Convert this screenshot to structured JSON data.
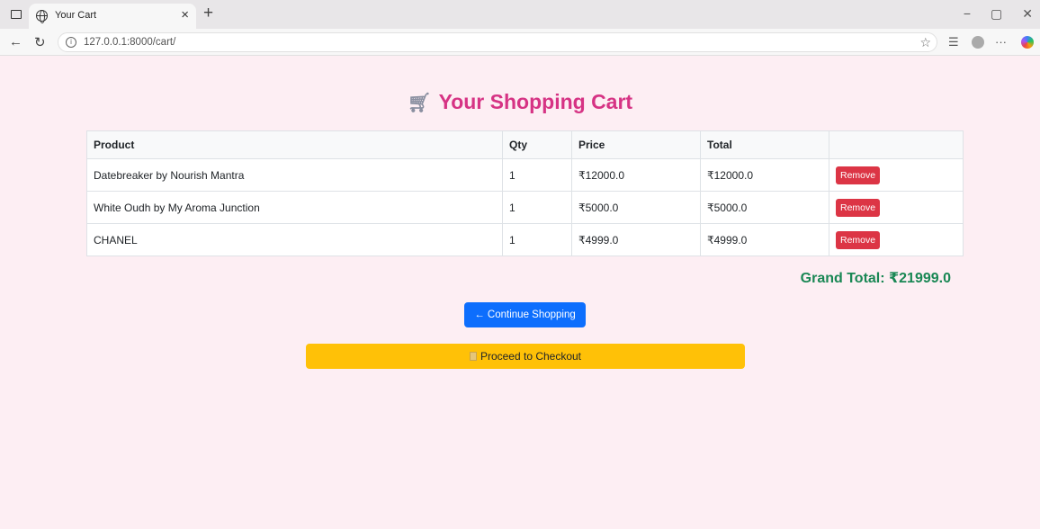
{
  "browser": {
    "tab_title": "Your Cart",
    "tab_close": "×",
    "new_tab": "+",
    "url": "127.0.0.1:8000/cart/",
    "window_controls": [
      "−",
      "▢",
      "✕"
    ]
  },
  "page": {
    "heading": "Your Shopping Cart",
    "table": {
      "headers": [
        "Product",
        "Qty",
        "Price",
        "Total",
        ""
      ],
      "rows": [
        {
          "product": "Datebreaker by Nourish Mantra",
          "qty": "1",
          "price": "₹12000.0",
          "total": "₹12000.0",
          "action": "Remove"
        },
        {
          "product": "White Oudh by My Aroma Junction",
          "qty": "1",
          "price": "₹5000.0",
          "total": "₹5000.0",
          "action": "Remove"
        },
        {
          "product": "CHANEL",
          "qty": "1",
          "price": "₹4999.0",
          "total": "₹4999.0",
          "action": "Remove"
        }
      ]
    },
    "grand_total": "Grand Total: ₹21999.0",
    "continue_button": "← Continue Shopping",
    "checkout_button": "Proceed to Checkout"
  },
  "colors": {
    "page_background": "#fdeef3",
    "heading": "#d63384",
    "remove_button": "#dc3545",
    "grand_total": "#198754",
    "continue_button": "#0d6efd",
    "checkout_button": "#ffc107"
  }
}
